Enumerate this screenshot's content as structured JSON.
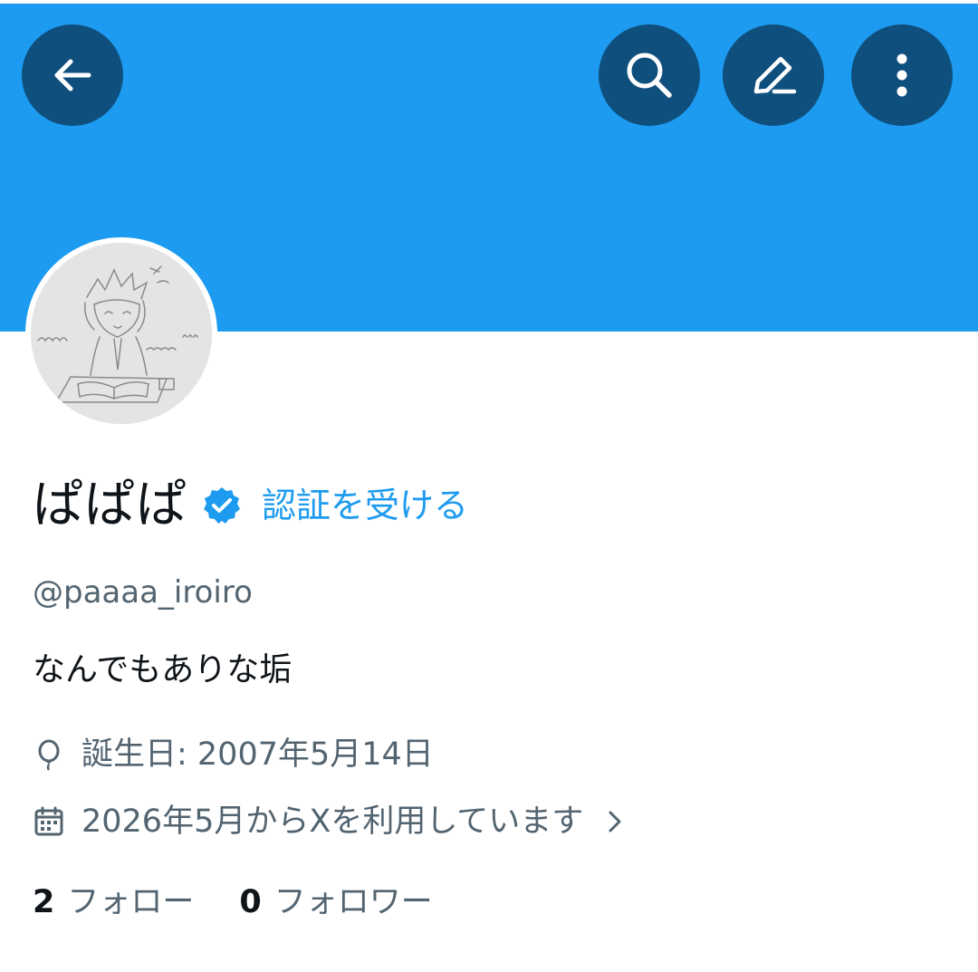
{
  "header": {
    "back_icon": "arrow-left-icon",
    "search_icon": "search-icon",
    "edit_icon": "pencil-icon",
    "more_icon": "more-vertical-icon",
    "banner_color": "#1d9bf0",
    "button_color": "#0f4f7d"
  },
  "profile": {
    "display_name": "ぱぱぱ",
    "verify_link": "認証を受ける",
    "handle": "@paaaa_iroiro",
    "bio": "なんでもありな垢",
    "birthday": "誕生日: 2007年5月14日",
    "joined": "2026年5月からXを利用しています",
    "accent_color": "#1d9bf0"
  },
  "stats": {
    "following_count": "2",
    "following_label": "フォロー",
    "followers_count": "0",
    "followers_label": "フォロワー"
  }
}
